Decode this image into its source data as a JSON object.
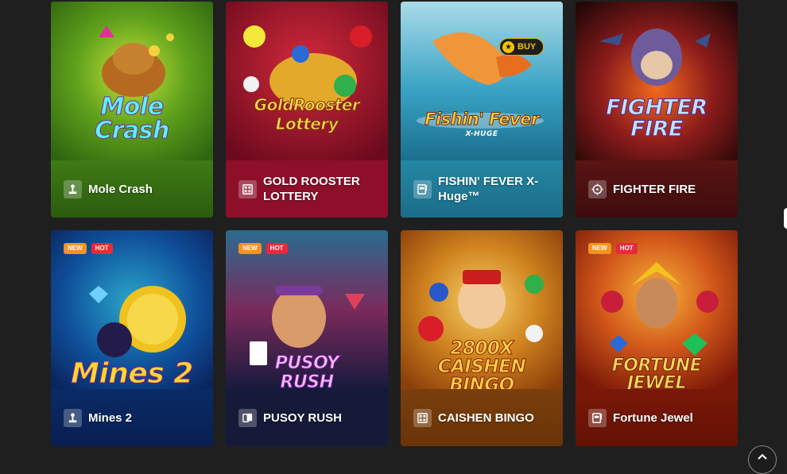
{
  "games": [
    {
      "name": "Mole Crash",
      "logo": "Mole Crash",
      "icon": "joystick-icon",
      "badges": []
    },
    {
      "name": "GOLD ROOSTER LOTTERY",
      "logo": "GoldRooster Lottery",
      "icon": "lottery-icon",
      "badges": []
    },
    {
      "name": "FISHIN' FEVER X-Huge™",
      "logo": "Fishin' Fever",
      "icon": "slot-machine-icon",
      "badges": [],
      "logo_sub": "X-HUGE",
      "buy_label": "BUY"
    },
    {
      "name": "FIGHTER FIRE",
      "logo": "FIGHTER FIRE",
      "icon": "crosshair-icon",
      "badges": []
    },
    {
      "name": "Mines 2",
      "logo": "Mines 2",
      "icon": "joystick-icon",
      "badges": [
        "NEW",
        "HOT"
      ]
    },
    {
      "name": "PUSOY RUSH",
      "logo": "PUSOY RUSH",
      "icon": "cards-icon",
      "badges": [
        "NEW",
        "HOT"
      ]
    },
    {
      "name": "CAISHEN BINGO",
      "logo": "2800X CAISHEN BINGO",
      "icon": "lottery-icon",
      "badges": []
    },
    {
      "name": "Fortune Jewel",
      "logo": "FORTUNE JEWEL",
      "icon": "slot-machine-icon",
      "badges": [
        "NEW",
        "HOT"
      ]
    }
  ],
  "colors": {
    "background": "#1f1f20",
    "badge_new": "#f39321",
    "badge_hot": "#e8283b"
  },
  "controls": {
    "scroll_top_icon": "chevron-up-icon"
  }
}
